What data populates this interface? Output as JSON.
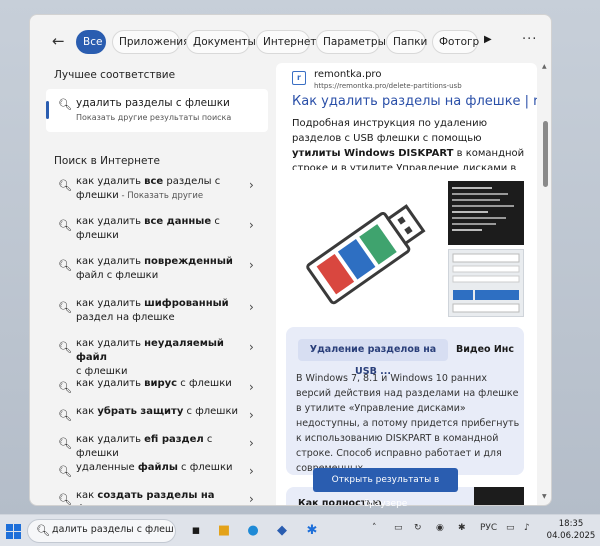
{
  "tabs": [
    {
      "label": "Все",
      "active": true
    },
    {
      "label": "Приложения"
    },
    {
      "label": "Документы"
    },
    {
      "label": "Интернет"
    },
    {
      "label": "Параметры"
    },
    {
      "label": "Папки"
    },
    {
      "label": "Фотогр"
    }
  ],
  "left": {
    "best_match_title": "Лучшее соответствие",
    "best_match": {
      "text": "удалить разделы с флешки",
      "subtext": "Показать другие результаты поиска"
    },
    "web_title": "Поиск в Интернете",
    "suggestions": [
      {
        "pre": "как удалить ",
        "bold": "все",
        "post": " разделы с",
        "line2": "флешки",
        "sub": " - Показать другие"
      },
      {
        "pre": "как удалить ",
        "bold": "все данные",
        "post": " с",
        "line2": "флешки",
        "sub": ""
      },
      {
        "pre": "как удалить ",
        "bold": "поврежденный",
        "post": "",
        "line2": "файл",
        "line2post": " с флешки",
        "sub": ""
      },
      {
        "pre": "как удалить ",
        "bold": "шифрованный",
        "post": "",
        "line2": "раздел на флешке",
        "sub": ""
      },
      {
        "pre": "как удалить ",
        "bold": "неудаляемый файл",
        "post": "",
        "line2": "с флешки",
        "sub": ""
      },
      {
        "pre": "как удалить ",
        "bold": "вирус",
        "post": " с флешки",
        "line2": "",
        "sub": ""
      },
      {
        "pre": "как ",
        "bold": "убрать защиту",
        "post": " с флешки",
        "line2": "",
        "sub": ""
      },
      {
        "pre": "как удалить ",
        "bold": "efi раздел",
        "post": " с флешки",
        "line2": "",
        "sub": ""
      },
      {
        "pre": "удаленные ",
        "bold": "файлы",
        "post": " с флешки",
        "line2": "",
        "sub": ""
      },
      {
        "pre": "как ",
        "bold": "создать разделы на флешке",
        "post": "",
        "line2": "",
        "sub": ""
      }
    ]
  },
  "right": {
    "site_name": "remontka.pro",
    "url": "https://remontka.pro/delete-partitions-usb",
    "title": "Как удалить разделы на флешке | re...",
    "desc_pre": "Подробная инструкция по удалению разделов с USB флешки с помощью ",
    "desc_bold": "утилиты Windows DISKPART",
    "desc_post": " в командной строке и в утилите Управление дисками в Windows 11, 10, 8.1 и 7.",
    "card_tab1": "Удаление разделов на USB ...",
    "card_tab2": "Видео Инс",
    "card_text": "В Windows 7, 8.1 и Windows 10 ранних версий действия над разделами на флешке в утилите «Управление дисками» недоступны, а потому придется прибегнуть к использованию DISKPART в командной строке. Способ исправно работает и для современных ...",
    "card2_text": "Как полностью",
    "open_button": "Открыть результаты в браузере"
  },
  "taskbar": {
    "search_value": "далить разделы с флешки",
    "lang": "РУС",
    "time": "18:35",
    "date": "04.06.2025"
  },
  "colors": {
    "accent": "#2a5db0",
    "link": "#2a4fa8"
  }
}
